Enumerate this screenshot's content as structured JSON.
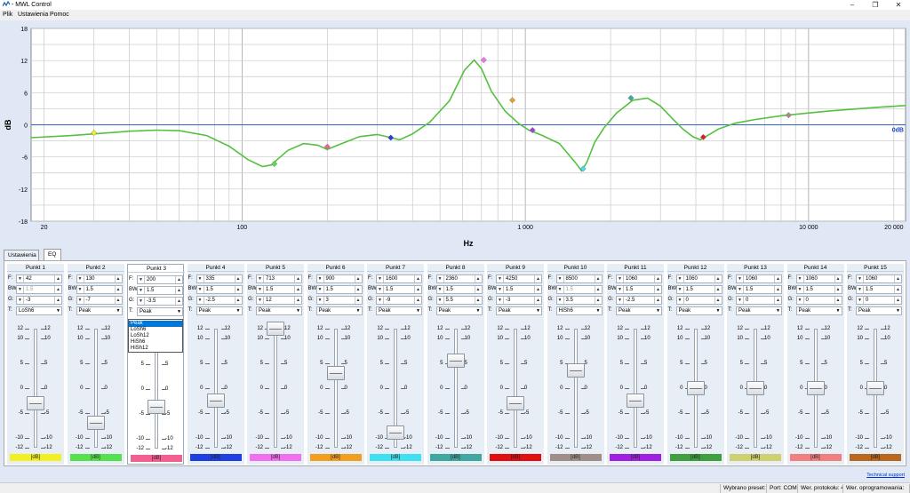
{
  "window": {
    "title": "- MWL Control",
    "min": "–",
    "restore": "❐",
    "close": "✕"
  },
  "menu": [
    "Plik",
    "Ustawienia",
    "Pomoc"
  ],
  "chart_data": {
    "type": "line",
    "xlabel": "Hz",
    "ylabel": "dB",
    "xscale": "log",
    "xlim": [
      18,
      22000
    ],
    "ylim": [
      -18,
      18
    ],
    "yticks": [
      18,
      12,
      6,
      0,
      -6,
      -12,
      -18
    ],
    "xticks": [
      {
        "v": 20,
        "label": "20"
      },
      {
        "v": 100,
        "label": "100"
      },
      {
        "v": 1000,
        "label": "1 000"
      },
      {
        "v": 10000,
        "label": "10 000"
      },
      {
        "v": 20000,
        "label": "20 000"
      }
    ],
    "zero_label": "0dB",
    "grid": true,
    "series": [
      {
        "color": "#55c040",
        "x": [
          18,
          25,
          32,
          40,
          50,
          60,
          75,
          90,
          105,
          118,
          127,
          133,
          145,
          165,
          185,
          200,
          225,
          260,
          300,
          330,
          360,
          400,
          460,
          540,
          610,
          660,
          700,
          760,
          850,
          950,
          1030,
          1150,
          1320,
          1500,
          1580,
          1650,
          1760,
          1900,
          2100,
          2400,
          2700,
          3000,
          3300,
          3600,
          3900,
          4150,
          4400,
          4800,
          5500,
          6500,
          8000,
          10000,
          12000,
          15000,
          18000,
          22000
        ],
        "y": [
          -2.4,
          -2.0,
          -1.6,
          -1.2,
          -1.0,
          -1.1,
          -2.0,
          -4.0,
          -6.5,
          -7.8,
          -7.5,
          -6.5,
          -4.8,
          -3.5,
          -3.8,
          -4.6,
          -3.5,
          -2.2,
          -1.8,
          -2.3,
          -2.8,
          -1.7,
          0.5,
          4.5,
          10.2,
          12.1,
          10.5,
          6.2,
          2.5,
          0.2,
          -1.0,
          -2.0,
          -3.5,
          -7.0,
          -8.6,
          -7.0,
          -3.2,
          -0.5,
          2.2,
          4.6,
          5.0,
          3.5,
          1.2,
          -0.8,
          -2.2,
          -2.8,
          -2.0,
          -0.8,
          0.3,
          1.0,
          1.7,
          2.2,
          2.6,
          3.0,
          3.3,
          3.6
        ]
      }
    ],
    "points": [
      {
        "x": 30,
        "y": -1.5,
        "color": "#f2f020"
      },
      {
        "x": 130,
        "y": -7.3,
        "color": "#55e050"
      },
      {
        "x": 200,
        "y": -4.1,
        "color": "#f060a0"
      },
      {
        "x": 335,
        "y": -2.4,
        "color": "#2040e0"
      },
      {
        "x": 713,
        "y": 12.1,
        "color": "#f070f0"
      },
      {
        "x": 900,
        "y": 4.6,
        "color": "#f0a020"
      },
      {
        "x": 1600,
        "y": -8.2,
        "color": "#40e0f0"
      },
      {
        "x": 2360,
        "y": 5.0,
        "color": "#40a8a0"
      },
      {
        "x": 4250,
        "y": -2.3,
        "color": "#e02020"
      },
      {
        "x": 8500,
        "y": 1.8,
        "color": "#a09080"
      },
      {
        "x": 1060,
        "y": -1.0,
        "color": "#a040e0"
      }
    ]
  },
  "tabs": [
    "Ustawienia",
    "EQ"
  ],
  "labels": {
    "f": "F:",
    "bw": "BW:",
    "g": "G:",
    "t": "T:"
  },
  "scale_ticks": [
    "12",
    "10",
    "5",
    "0",
    "-5",
    "-10",
    "-12"
  ],
  "db_label": "[dB]",
  "punkty": [
    {
      "title": "Punkt 1",
      "f": "42",
      "bw": "1.5",
      "g": "-3",
      "type": "LoSh6",
      "gain": -3,
      "color": "#f2f020",
      "bw_disabled": true
    },
    {
      "title": "Punkt 2",
      "f": "130",
      "bw": "1.5",
      "g": "-7",
      "type": "Peak",
      "gain": -7,
      "color": "#55e050"
    },
    {
      "title": "Punkt 3",
      "f": "200",
      "bw": "1.5",
      "g": "-3.5",
      "type": "Peak",
      "gain": -3.5,
      "color": "#f06090"
    },
    {
      "title": "Punkt 4",
      "f": "335",
      "bw": "1.5",
      "g": "-2.5",
      "type": "Peak",
      "gain": -2.5,
      "color": "#2040e0"
    },
    {
      "title": "Punkt 5",
      "f": "713",
      "bw": "1.5",
      "g": "12",
      "type": "Peak",
      "gain": 12,
      "color": "#f070f0"
    },
    {
      "title": "Punkt 6",
      "f": "900",
      "bw": "1.5",
      "g": "3",
      "type": "Peak",
      "gain": 3,
      "color": "#f0a020"
    },
    {
      "title": "Punkt 7",
      "f": "1600",
      "bw": "1.5",
      "g": "-9",
      "type": "Peak",
      "gain": -9,
      "color": "#40e0f0"
    },
    {
      "title": "Punkt 8",
      "f": "2360",
      "bw": "1.5",
      "g": "5.5",
      "type": "Peak",
      "gain": 5.5,
      "color": "#40a8a0"
    },
    {
      "title": "Punkt 9",
      "f": "4250",
      "bw": "1.5",
      "g": "-3",
      "type": "Peak",
      "gain": -3,
      "color": "#e01010"
    },
    {
      "title": "Punkt 10",
      "f": "8500",
      "bw": "1.5",
      "g": "3.5",
      "type": "HiSh6",
      "gain": 3.5,
      "color": "#a08f88",
      "bw_disabled": true
    },
    {
      "title": "Punkt 11",
      "f": "1060",
      "bw": "1.5",
      "g": "-2.5",
      "type": "Peak",
      "gain": -2.5,
      "color": "#a020e0"
    },
    {
      "title": "Punkt 12",
      "f": "1060",
      "bw": "1.5",
      "g": "0",
      "type": "Peak",
      "gain": 0,
      "color": "#40a040"
    },
    {
      "title": "Punkt 13",
      "f": "1060",
      "bw": "1.5",
      "g": "0",
      "type": "Peak",
      "gain": 0,
      "color": "#d0d070"
    },
    {
      "title": "Punkt 14",
      "f": "1060",
      "bw": "1.5",
      "g": "0",
      "type": "Peak",
      "gain": 0,
      "color": "#f08080"
    },
    {
      "title": "Punkt 15",
      "f": "1060",
      "bw": "1.5",
      "g": "0",
      "type": "Peak",
      "gain": 0,
      "color": "#b86820"
    }
  ],
  "dropdown": {
    "options": [
      "Peak",
      "LoSh6",
      "LoSh12",
      "HiSh6",
      "HiSh12"
    ],
    "highlighted": 0,
    "for_punkt": 3
  },
  "link": "Technical support",
  "status": [
    "Wybrano preset: 1",
    "Port: COM7",
    "Wer. protokołu: 4",
    "Wer. oprogramowania: 7"
  ]
}
